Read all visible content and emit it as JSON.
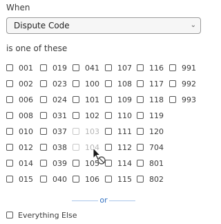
{
  "when_label": "When",
  "select": {
    "value": "Dispute Code"
  },
  "list_label": "is one of these",
  "codes": [
    [
      "001",
      "019",
      "041",
      "107",
      "116",
      "991"
    ],
    [
      "002",
      "023",
      "100",
      "108",
      "117",
      "992"
    ],
    [
      "006",
      "024",
      "101",
      "109",
      "118",
      "993"
    ],
    [
      "008",
      "031",
      "102",
      "110",
      "119",
      ""
    ],
    [
      "010",
      "037",
      "103",
      "111",
      "120",
      ""
    ],
    [
      "012",
      "038",
      "104",
      "112",
      "704",
      ""
    ],
    [
      "014",
      "039",
      "105",
      "114",
      "801",
      ""
    ],
    [
      "015",
      "040",
      "106",
      "115",
      "802",
      ""
    ]
  ],
  "disabled_codes": [
    "103",
    "104"
  ],
  "or_text": "or",
  "everything_else_label": "Everything Else"
}
